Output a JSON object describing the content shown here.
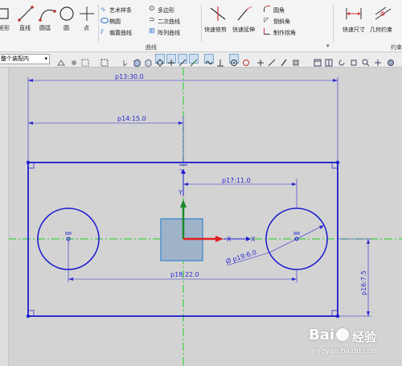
{
  "ribbon": {
    "tools": {
      "rectangle": "矩形",
      "line": "直线",
      "arc": "圆弧",
      "circle": "圆",
      "point": "点"
    },
    "curve_col1": [
      "艺术样条",
      "椭圆",
      "偏置曲线"
    ],
    "curve_col2": [
      "多边形",
      "二次曲线",
      "阵列曲线"
    ],
    "edit": {
      "quick_trim": "快速修剪",
      "quick_extend": "快速延伸",
      "fillet": "圆角",
      "chamfer": "倒斜角",
      "make_corner": "制作拐角"
    },
    "dims": {
      "quick_dimension": "快速尺寸",
      "geometric_constraint": "几何约束"
    },
    "group_curve": "曲线",
    "group_constraint": "约束"
  },
  "toolbar": {
    "selection_filter": "整个装配内"
  },
  "sketch": {
    "dims": {
      "p13": "p13:30.0",
      "p14": "p14:15.0",
      "p17": "p17:11.0",
      "p18": "p18:22.0",
      "p16": "p16:7.5",
      "p19": "Ø p19:6.0"
    },
    "axis_y": "Y",
    "axis_x": "X",
    "axis_x2": "X",
    "axis_y2": "Y"
  },
  "watermark": {
    "brand": "Bai",
    "brand_cn": "经验",
    "url": "jingyan.baidu.com"
  },
  "colors": {
    "sketch_blue": "#1c1ccf",
    "center_green": "#22cc22",
    "axis_red": "#e02020",
    "axis_green": "#1a8a2a"
  }
}
